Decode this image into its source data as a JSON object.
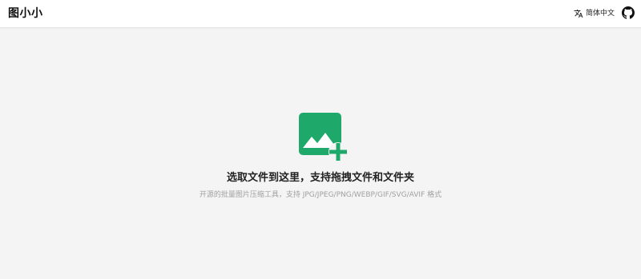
{
  "header": {
    "logo": "图小小",
    "language_icon": "translate-icon",
    "language_label": "简体中文",
    "github_icon": "github-icon"
  },
  "dropzone": {
    "icon": "add-image-icon",
    "title": "选取文件到这里，支持拖拽文件和文件夹",
    "subtitle": "开源的批量图片压缩工具，支持 JPG/JPEG/PNG/WEBP/GIF/SVG/AVIF 格式"
  },
  "colors": {
    "accent": "#1ea86a",
    "background": "#f4f4f4",
    "header_bg": "#ffffff",
    "subtitle_text": "#a0a0a0"
  }
}
